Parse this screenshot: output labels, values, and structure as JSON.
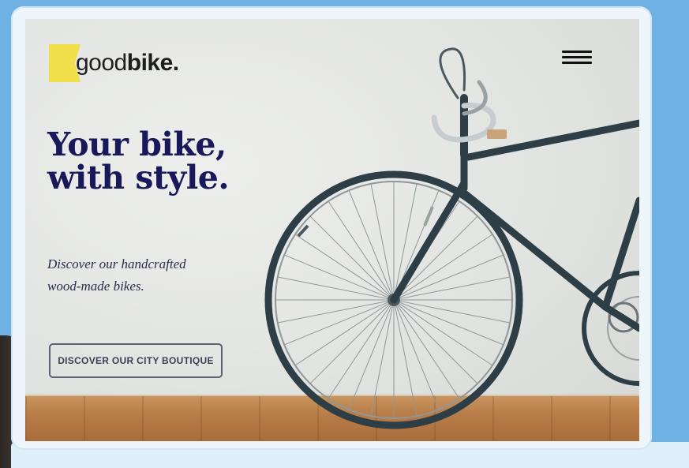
{
  "brand": {
    "name_light": "good",
    "name_bold": "bike."
  },
  "hero": {
    "title_line1": "Your bike,",
    "title_line2": "with style.",
    "tagline_line1": "Discover our handcrafted",
    "tagline_line2": "wood-made bikes.",
    "cta_label": "DISCOVER OUR CITY BOUTIQUE"
  },
  "icons": {
    "menu": "hamburger-menu-icon",
    "logo": "goodbike-logo-mark"
  },
  "colors": {
    "brand_yellow": "#f1de4b",
    "heading_navy": "#18185a",
    "background_blue": "#6fb2e3",
    "bike_frame": "#2d3e47"
  }
}
